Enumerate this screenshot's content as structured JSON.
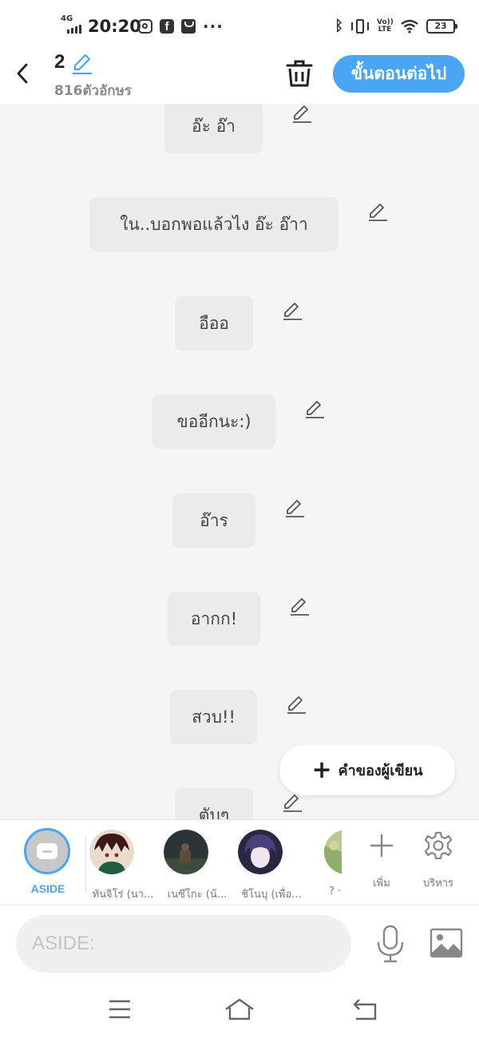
{
  "status_bar": {
    "network": "4G",
    "time": "20:20",
    "volte": "Vo)) LTE",
    "battery": "23"
  },
  "header": {
    "title": "2",
    "char_count": "816ตัวอักษร",
    "next_label": "ขั้นตอนต่อไป"
  },
  "messages": [
    {
      "text": "อ๊ะ อ๊า"
    },
    {
      "text": "ใน..บอกพอแล้วไง อ๊ะ อ๊าา"
    },
    {
      "text": "อืออ"
    },
    {
      "text": "ขออีกนะ:)"
    },
    {
      "text": "อ๊าร"
    },
    {
      "text": "อากก!"
    },
    {
      "text": "สวบ!!"
    },
    {
      "text": "ตับๆ"
    }
  ],
  "writer_fab": {
    "label": "คำของผู้เขียน"
  },
  "characters": {
    "aside_label": "ASIDE",
    "items": [
      {
        "name": "ทันจิโร่ (นา...",
        "avatar_color": "#7a3b2e"
      },
      {
        "name": "เนซึโกะ (น้...",
        "avatar_color": "#2f3b3d"
      },
      {
        "name": "ชิโนบุ (เพื่อ...",
        "avatar_color": "#3a3550"
      },
      {
        "name": "? ·",
        "avatar_color": "#8fae6a"
      }
    ],
    "add_label": "เพิ่ม",
    "manage_label": "บริหาร"
  },
  "input": {
    "placeholder": "ASIDE:"
  },
  "colors": {
    "accent": "#4aa6f3",
    "bubble": "#ebebeb",
    "background": "#f5f5f5"
  }
}
